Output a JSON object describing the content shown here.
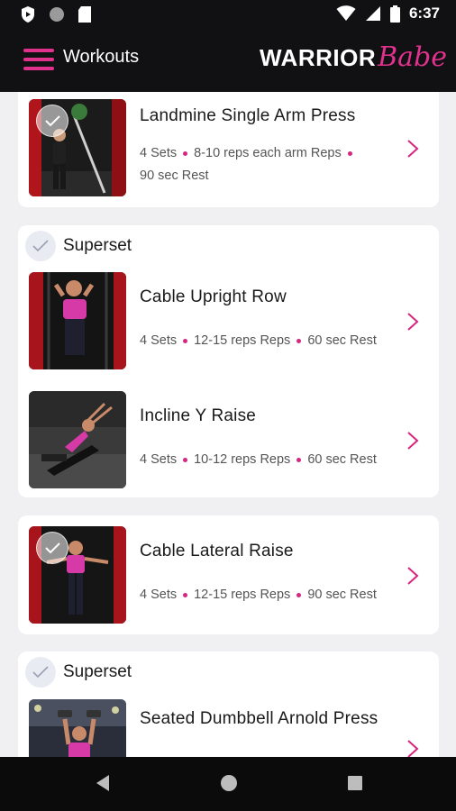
{
  "status_bar": {
    "time": "6:37"
  },
  "app_bar": {
    "title": "Workouts",
    "logo_part1": "WARRIOR",
    "logo_part2": "Babe"
  },
  "colors": {
    "accent": "#e0328d",
    "appbar_bg": "#111114",
    "page_bg": "#f0f0f2"
  },
  "exercises": {
    "landmine": {
      "name": "Landmine Single Arm Press",
      "sets": "4 Sets",
      "reps": "8-10 reps each arm Reps",
      "rest": "90 sec Rest"
    },
    "upright_row": {
      "name": "Cable Upright Row",
      "sets": "4 Sets",
      "reps": "12-15 reps Reps",
      "rest": "60 sec Rest"
    },
    "incline_y": {
      "name": "Incline Y Raise",
      "sets": "4 Sets",
      "reps": "10-12 reps Reps",
      "rest": "60 sec Rest"
    },
    "lateral_raise": {
      "name": "Cable Lateral Raise",
      "sets": "4 Sets",
      "reps": "12-15 reps Reps",
      "rest": "90 sec Rest"
    },
    "arnold_press": {
      "name": "Seated Dumbbell Arnold Press"
    }
  },
  "superset_label": "Superset",
  "icons": {
    "menu": "hamburger-menu-icon",
    "chevron": "chevron-right-icon",
    "check": "checkmark-icon",
    "nav_back": "back-triangle-icon",
    "nav_home": "home-circle-icon",
    "nav_recents": "recents-square-icon"
  }
}
